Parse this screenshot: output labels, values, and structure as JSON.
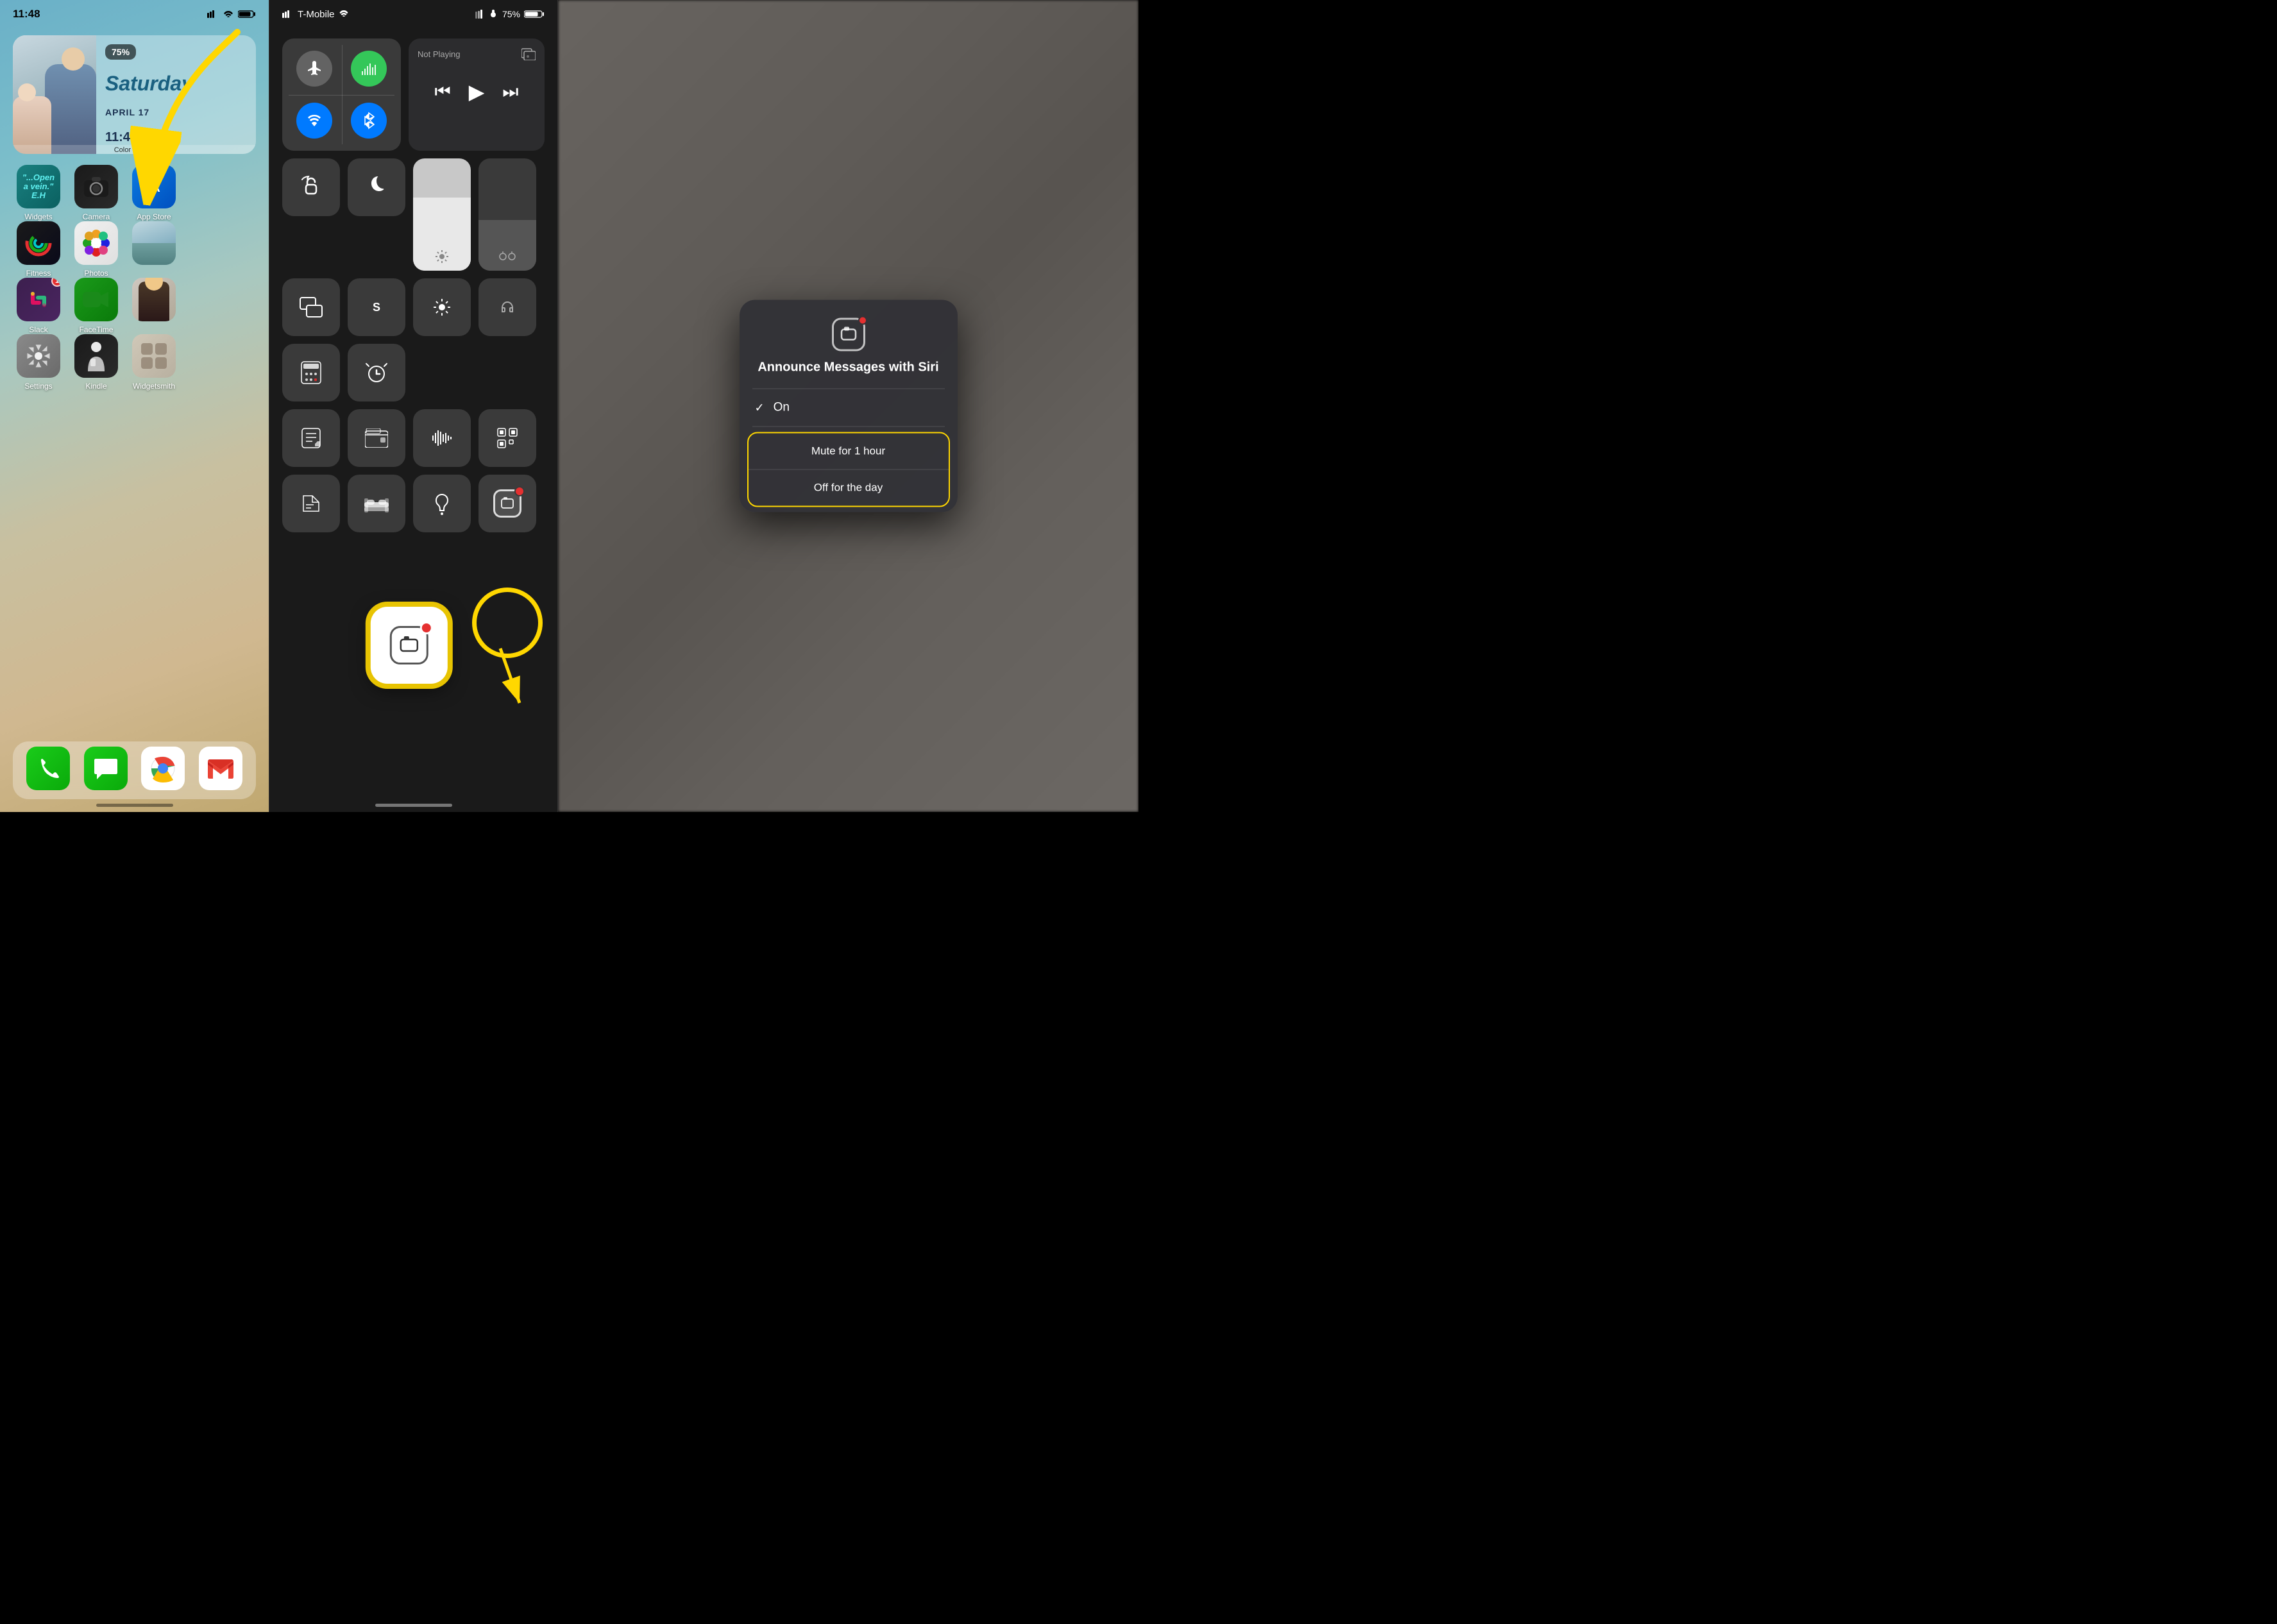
{
  "panel1": {
    "time": "11:48",
    "statusIcons": "●● ▲ 🔋",
    "widget": {
      "battery": "75%",
      "dayScript": "Saturday",
      "dateLabel": "APRIL 17",
      "timeRight": "11:48",
      "widgetLabel": "Color Widget"
    },
    "apps": {
      "row1": [
        {
          "name": "Widgets",
          "label": "Widgets"
        },
        {
          "name": "Camera",
          "label": "Camera"
        },
        {
          "name": "App Store",
          "label": "App Store"
        }
      ],
      "row2": [
        {
          "name": "Fitness",
          "label": "Fitness"
        },
        {
          "name": "Photos",
          "label": "Photos"
        },
        {
          "name": "Photo Thumb",
          "label": ""
        }
      ],
      "row3": [
        {
          "name": "Slack",
          "label": "Slack",
          "badge": "1"
        },
        {
          "name": "FaceTime",
          "label": "FaceTime"
        },
        {
          "name": "Baby Photo",
          "label": ""
        }
      ],
      "row4": [
        {
          "name": "Settings",
          "label": "Settings"
        },
        {
          "name": "Kindle",
          "label": "Kindle"
        },
        {
          "name": "Widgetsmith",
          "label": "Widgetsmith"
        }
      ]
    },
    "dock": {
      "apps": [
        "Phone",
        "Messages",
        "Chrome",
        "Gmail"
      ]
    }
  },
  "panel2": {
    "carrier": "T-Mobile",
    "battery": "75%",
    "notPlaying": "Not Playing",
    "tiles": {
      "airplane": "Airplane Mode",
      "cellular": "Cellular",
      "wifi": "Wi-Fi",
      "bluetooth": "Bluetooth"
    }
  },
  "panel3": {
    "popup": {
      "title": "Announce Messages with Siri",
      "option_on_label": "On",
      "option_mute": "Mute for 1 hour",
      "option_off": "Off for the day"
    }
  }
}
